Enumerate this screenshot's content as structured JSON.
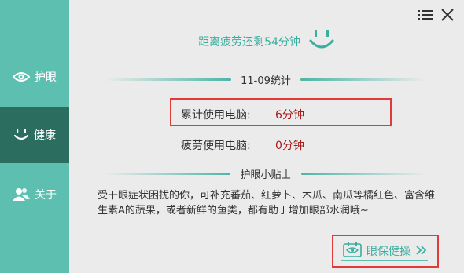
{
  "sidebar": {
    "items": [
      {
        "label": "护眼",
        "icon": "eye-icon",
        "active": false
      },
      {
        "label": "健康",
        "icon": "smile-icon",
        "active": true
      },
      {
        "label": "关于",
        "icon": "users-icon",
        "active": false
      }
    ]
  },
  "header": {
    "menu_icon": "menu-icon",
    "close_icon": "close-icon"
  },
  "countdown": {
    "text": "距离疲劳还剩54分钟",
    "icon": "smiley-face-icon"
  },
  "stats": {
    "title": "11-09统计",
    "total_label": "累计使用电脑:",
    "total_value": "6分钟",
    "fatigue_label": "疲劳使用电脑:",
    "fatigue_value": "0分钟"
  },
  "tips": {
    "title": "护眼小贴士",
    "body": "受干眼症状困扰的你，可补充蕃茄、红萝卜、木瓜、南瓜等橘红色、富含维生素A的蔬果，或者新鲜的鱼类，都有助于增加眼部水润哦~"
  },
  "exercise": {
    "label": "眼保健操",
    "icon": "eye-card-icon",
    "arrow_icon": "double-chevron-right-icon"
  },
  "colors": {
    "sidebar": "#5dbfb0",
    "sidebar_active": "#2b6d5f",
    "accent": "#3aae9f",
    "highlight_border": "#e03a3a",
    "value_red": "#a81b1b",
    "background": "#ebebeb"
  }
}
